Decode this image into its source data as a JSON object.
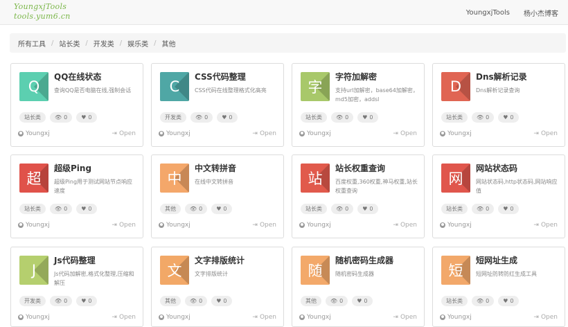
{
  "header": {
    "logo_line1": "YoungxjTools",
    "logo_line2": "tools.yum6.cn",
    "nav": [
      "YoungxjTools",
      "杨小杰博客"
    ]
  },
  "breadcrumb": [
    "所有工具",
    "站长类",
    "开发类",
    "娱乐类",
    "其他"
  ],
  "cards": [
    {
      "title": "QQ在线状态",
      "desc": "查询QQ是否电脑在线,强制会话",
      "icon_char": "Q",
      "color": "#5ccfb0",
      "category": "站长类",
      "views": "0",
      "likes": "0",
      "author": "Youngxj",
      "open_label": "Open"
    },
    {
      "title": "CSS代码整理",
      "desc": "CSS代码在线整理格式化高亮",
      "icon_char": "C",
      "color": "#4fa7a5",
      "category": "开发类",
      "views": "0",
      "likes": "0",
      "author": "Youngxj",
      "open_label": "Open"
    },
    {
      "title": "字符加解密",
      "desc": "支持url加解密，base64加解密，md5加密，addsl",
      "icon_char": "字",
      "color": "#a8c86a",
      "category": "站长类",
      "views": "0",
      "likes": "0",
      "author": "Youngxj",
      "open_label": "Open"
    },
    {
      "title": "Dns解析记录",
      "desc": "Dns解析记录查询",
      "icon_char": "D",
      "color": "#e06553",
      "category": "站长类",
      "views": "0",
      "likes": "0",
      "author": "Youngxj",
      "open_label": "Open"
    },
    {
      "title": "超级Ping",
      "desc": "超级Ping用于测试网站节点响应速度",
      "icon_char": "超",
      "color": "#e0524a",
      "category": "站长类",
      "views": "0",
      "likes": "0",
      "author": "Youngxj",
      "open_label": "Open"
    },
    {
      "title": "中文转拼音",
      "desc": "在线中文转拼音",
      "icon_char": "中",
      "color": "#f4a76a",
      "category": "其他",
      "views": "0",
      "likes": "0",
      "author": "Youngxj",
      "open_label": "Open"
    },
    {
      "title": "站长权重查询",
      "desc": "百度权重,360权重,神马权重,站长权重查询",
      "icon_char": "站",
      "color": "#e15a4c",
      "category": "站长类",
      "views": "0",
      "likes": "0",
      "author": "Youngxj",
      "open_label": "Open"
    },
    {
      "title": "网站状态码",
      "desc": "网站状态码,http状态码,网站响应值",
      "icon_char": "网",
      "color": "#e0564c",
      "category": "站长类",
      "views": "0",
      "likes": "0",
      "author": "Youngxj",
      "open_label": "Open"
    },
    {
      "title": "Js代码整理",
      "desc": "Js代码加解密,格式化整理,压缩和解压",
      "icon_char": "J",
      "color": "#b5cf6e",
      "category": "开发类",
      "views": "0",
      "likes": "0",
      "author": "Youngxj",
      "open_label": "Open"
    },
    {
      "title": "文字排版统计",
      "desc": "文字排版统计",
      "icon_char": "文",
      "color": "#f2a867",
      "category": "其他",
      "views": "0",
      "likes": "0",
      "author": "Youngxj",
      "open_label": "Open"
    },
    {
      "title": "随机密码生成器",
      "desc": "随机密码生成器",
      "icon_char": "随",
      "color": "#f3a96a",
      "category": "其他",
      "views": "0",
      "likes": "0",
      "author": "Youngxj",
      "open_label": "Open"
    },
    {
      "title": "短网址生成",
      "desc": "短网址防转防红生成工具",
      "icon_char": "短",
      "color": "#f2a86a",
      "category": "站长类",
      "views": "0",
      "likes": "0",
      "author": "Youngxj",
      "open_label": "Open"
    }
  ]
}
